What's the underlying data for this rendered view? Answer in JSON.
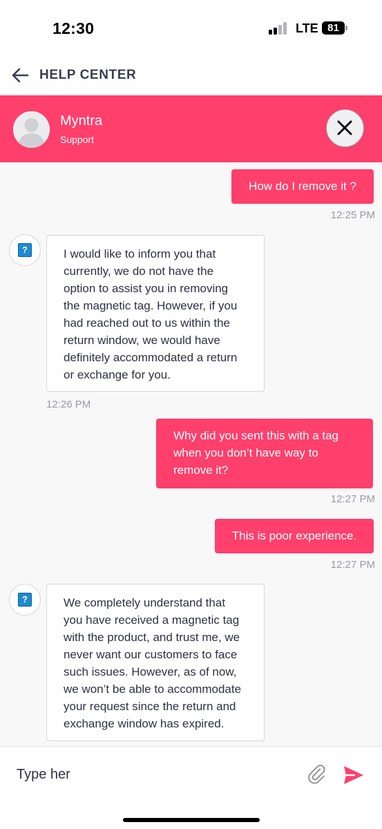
{
  "status_bar": {
    "time": "12:30",
    "network": "LTE",
    "battery": "81"
  },
  "nav": {
    "title": "HELP CENTER"
  },
  "chat_header": {
    "agent_name": "Myntra",
    "agent_subtitle": "Support"
  },
  "messages": [
    {
      "sender": "user",
      "text": "How do I remove it ?",
      "time": "12:25 PM"
    },
    {
      "sender": "bot",
      "lines": [
        "I would like to inform you that",
        "currently, we do not have the",
        "option to assist you in removing",
        "the magnetic tag. However, if you",
        "had reached out to us within the",
        "return window, we would have",
        "definitely accommodated a return",
        "or exchange for you."
      ],
      "time": "12:26 PM"
    },
    {
      "sender": "user",
      "lines": [
        "Why did you sent this with a tag",
        "when you don’t have way to",
        "remove it?"
      ],
      "time": "12:27 PM"
    },
    {
      "sender": "user",
      "text": "This is poor experience.",
      "time": "12:27 PM"
    },
    {
      "sender": "bot",
      "lines": [
        "We completely understand that",
        "you have received a magnetic tag",
        "with the product, and trust me, we",
        "never want our customers to face",
        "such issues. However, as of now,",
        "we won’t be able to accommodate",
        "your request since the return and",
        "exchange window has expired."
      ]
    }
  ],
  "input": {
    "value": "Type her"
  },
  "colors": {
    "brand": "#ff3f6c",
    "bot_icon": "#1f8ad0"
  },
  "icons": {
    "back": "arrow-left-icon",
    "close": "close-icon",
    "bot": "question-icon",
    "attach": "paperclip-icon",
    "send": "send-icon"
  }
}
